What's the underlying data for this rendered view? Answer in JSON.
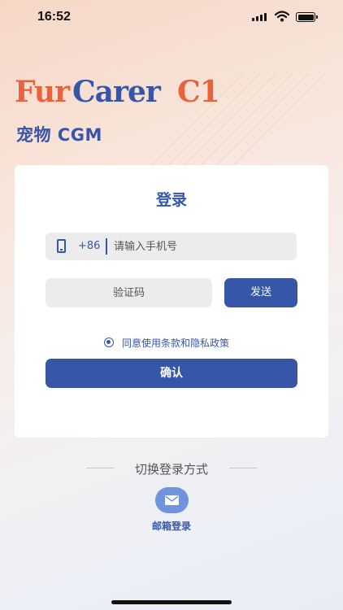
{
  "status_bar": {
    "time": "16:52"
  },
  "brand": {
    "logo_text": "FurCarer C1",
    "subtitle": "宠物 CGM"
  },
  "login_card": {
    "title": "登录",
    "country_code": "+86",
    "phone_placeholder": "请输入手机号",
    "code_placeholder": "验证码",
    "send_label": "发送",
    "agreement_text": "同意使用条款和隐私政策",
    "confirm_label": "确认"
  },
  "switch_login": {
    "label": "切换登录方式",
    "email_label": "邮箱登录"
  },
  "colors": {
    "brand_blue": "#3656a8",
    "logo_orange": "#e8623c",
    "email_button": "#6f93dd"
  },
  "icons": {
    "phone": "phone-icon",
    "email": "mail-icon",
    "radio": "radio-selected-icon"
  }
}
